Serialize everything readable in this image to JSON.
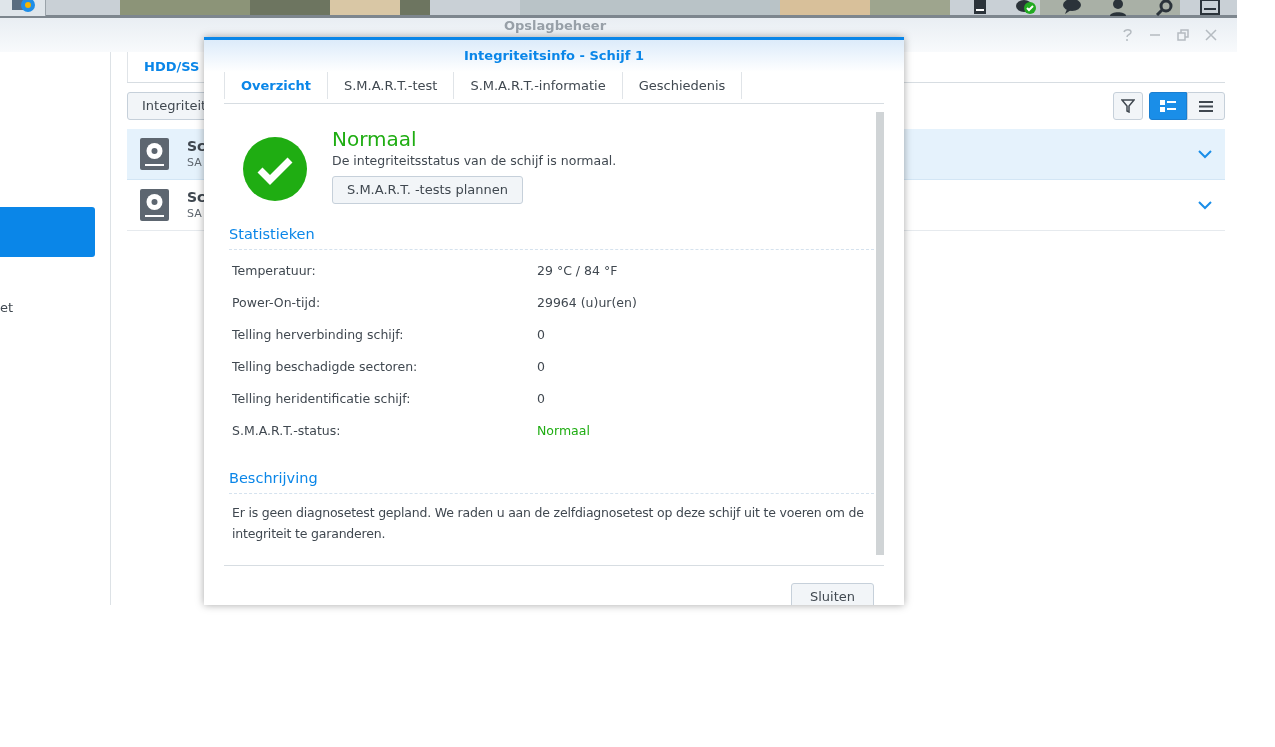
{
  "window": {
    "title": "Opslagbeheer"
  },
  "sidebar": {
    "items": [
      {
        "selected": true
      },
      {
        "label": "et",
        "selected": false
      }
    ]
  },
  "main": {
    "tabs": [
      {
        "label": "HDD/SS",
        "selected": true
      }
    ],
    "toolbar": {
      "button": "Integriteit",
      "view_modes": [
        {
          "kind": "detail",
          "selected": true
        },
        {
          "kind": "list",
          "selected": false
        }
      ]
    },
    "disks": [
      {
        "name": "Sc",
        "subtitle": "SA",
        "selected": true
      },
      {
        "name": "Sc",
        "subtitle": "SA",
        "selected": false
      }
    ]
  },
  "dialog": {
    "title": "Integriteitsinfo - Schijf 1",
    "tabs": [
      {
        "label": "Overzicht",
        "selected": true
      },
      {
        "label": "S.M.A.R.T.-test",
        "selected": false
      },
      {
        "label": "S.M.A.R.T.-informatie",
        "selected": false
      },
      {
        "label": "Geschiedenis",
        "selected": false
      }
    ],
    "status": {
      "title": "Normaal",
      "message": "De integriteitsstatus van de schijf is normaal.",
      "button": "S.M.A.R.T. -tests plannen"
    },
    "statistics": {
      "heading": "Statistieken",
      "rows": [
        {
          "label": "Temperatuur:",
          "value": "29 °C / 84 °F",
          "kind": "text"
        },
        {
          "label": "Power-On-tijd:",
          "value": "29964 (u)ur(en)",
          "kind": "text"
        },
        {
          "label": "Telling herverbinding schijf:",
          "value": "0",
          "kind": "text"
        },
        {
          "label": "Telling beschadigde sectoren:",
          "value": "0",
          "kind": "text"
        },
        {
          "label": "Telling heridentificatie schijf:",
          "value": "0",
          "kind": "text"
        },
        {
          "label": "S.M.A.R.T.-status:",
          "value": "Normaal",
          "kind": "status"
        }
      ]
    },
    "description": {
      "heading": "Beschrijving",
      "text": "Er is geen diagnosetest gepland. We raden u aan de zelfdiagnosetest op deze schijf uit te voeren om de integriteit te garanderen."
    },
    "close_button": "Sluiten"
  }
}
